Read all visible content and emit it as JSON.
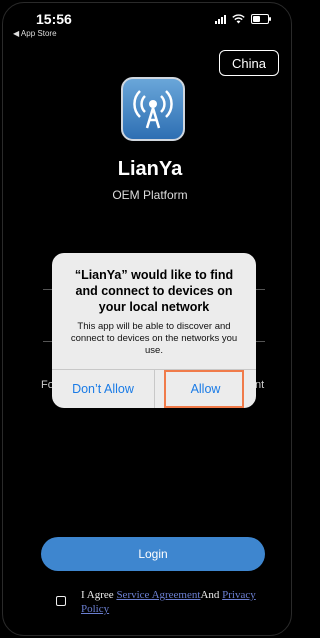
{
  "status_bar": {
    "time": "15:56",
    "back_app": "◀ App Store"
  },
  "header": {
    "region_button": "China"
  },
  "app": {
    "name": "LianYa",
    "subtitle": "OEM Platform"
  },
  "background": {
    "left_partial": "Fo",
    "right_partial": "nt"
  },
  "alert": {
    "title": "“LianYa” would like to find and connect to devices on your local network",
    "message": "This app will be able to discover and connect to devices on the networks you use.",
    "deny_label": "Don’t Allow",
    "allow_label": "Allow"
  },
  "login": {
    "label": "Login"
  },
  "agreement": {
    "prefix": "I Agree ",
    "service_link": "Service Agreement",
    "middle": "And ",
    "privacy_link": "Privacy Policy"
  },
  "colors": {
    "accent": "#3e86cf",
    "alert_button": "#1a7be6",
    "highlight": "#f07b4a"
  }
}
